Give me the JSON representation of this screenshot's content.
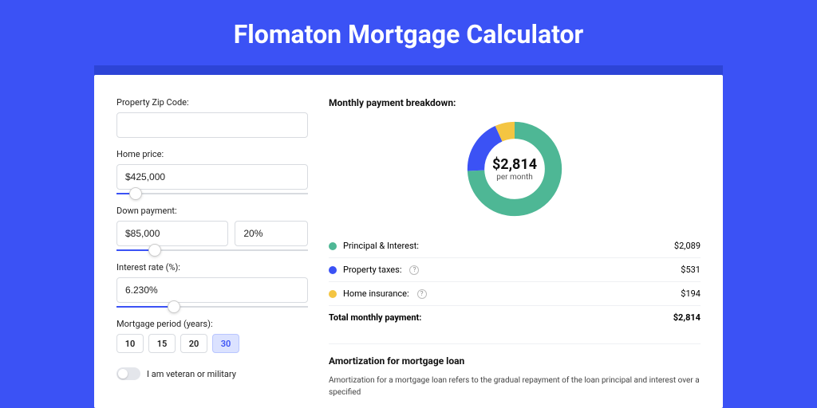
{
  "page": {
    "title": "Flomaton Mortgage Calculator"
  },
  "form": {
    "zip": {
      "label": "Property Zip Code:",
      "value": ""
    },
    "home_price": {
      "label": "Home price:",
      "value": "$425,000",
      "slider_pct": 10
    },
    "down_payment": {
      "label": "Down payment:",
      "value": "$85,000",
      "pct_value": "20%",
      "slider_pct": 20
    },
    "interest_rate": {
      "label": "Interest rate (%):",
      "value": "6.230%",
      "slider_pct": 30
    },
    "period": {
      "label": "Mortgage period (years):",
      "options": [
        "10",
        "15",
        "20",
        "30"
      ],
      "selected": "30"
    },
    "veteran": {
      "label": "I am veteran or military",
      "checked": false
    }
  },
  "breakdown": {
    "title": "Monthly payment breakdown:",
    "donut": {
      "amount": "$2,814",
      "sub": "per month"
    },
    "items": [
      {
        "color": "#4eb795",
        "label": "Principal & Interest:",
        "value": "$2,089",
        "info": false
      },
      {
        "color": "#3b52f5",
        "label": "Property taxes:",
        "value": "$531",
        "info": true
      },
      {
        "color": "#f4c542",
        "label": "Home insurance:",
        "value": "$194",
        "info": true
      }
    ],
    "total": {
      "label": "Total monthly payment:",
      "value": "$2,814"
    }
  },
  "chart_data": {
    "type": "pie",
    "title": "Monthly payment breakdown",
    "series": [
      {
        "name": "Principal & Interest",
        "value": 2089,
        "color": "#4eb795"
      },
      {
        "name": "Property taxes",
        "value": 531,
        "color": "#3b52f5"
      },
      {
        "name": "Home insurance",
        "value": 194,
        "color": "#f4c542"
      }
    ],
    "center_label": "$2,814 per month"
  },
  "amortization": {
    "title": "Amortization for mortgage loan",
    "text": "Amortization for a mortgage loan refers to the gradual repayment of the loan principal and interest over a specified"
  }
}
